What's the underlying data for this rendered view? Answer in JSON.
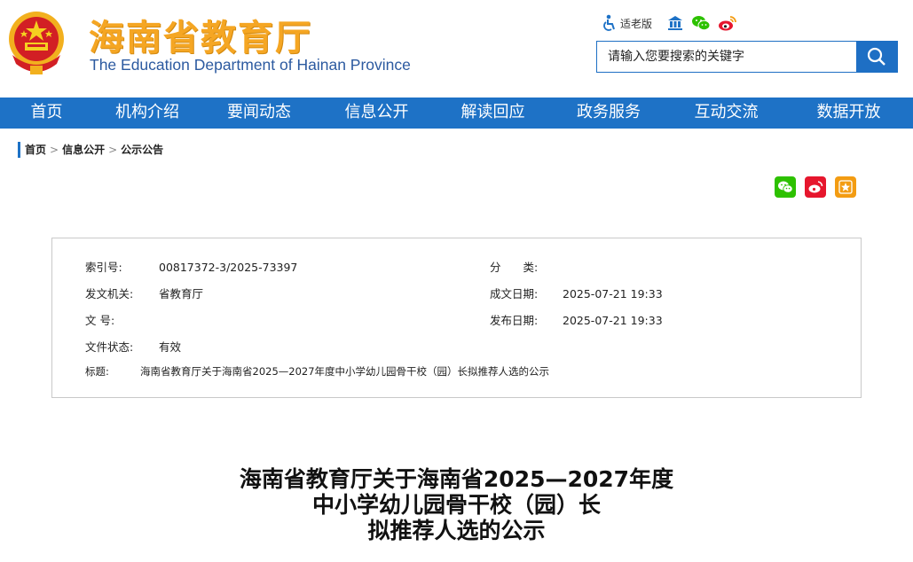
{
  "header": {
    "title_cn": "海南省教育厅",
    "title_en": "The Education Department of Hainan Province",
    "elder_mode_label": "适老版",
    "search_placeholder": "请输入您要搜索的关键字"
  },
  "nav": {
    "items": [
      "首页",
      "机构介绍",
      "要闻动态",
      "信息公开",
      "解读回应",
      "政务服务",
      "互动交流",
      "数据开放"
    ]
  },
  "breadcrumb": {
    "items": [
      "首页",
      "信息公开",
      "公示公告"
    ],
    "separator": ">"
  },
  "info": {
    "index_label": "索引号:",
    "index_value": "00817372-3/2025-73397",
    "category_label": "分　　类:",
    "category_value": "",
    "issuer_label": "发文机关:",
    "issuer_value": "省教育厅",
    "written_label": "成文日期:",
    "written_value": "2025-07-21 19:33",
    "docno_label": "文    号:",
    "docno_value": "",
    "published_label": "发布日期:",
    "published_value": "2025-07-21 19:33",
    "status_label": "文件状态:",
    "status_value": "有效",
    "title_label": "标题:",
    "title_value": "海南省教育厅关于海南省2025—2027年度中小学幼儿园骨干校（园）长拟推荐人选的公示"
  },
  "article": {
    "title_line1": "海南省教育厅关于海南省2025—2027年度",
    "title_line2": "中小学幼儿园骨干校（园）长",
    "title_line3": "拟推荐人选的公示"
  },
  "colors": {
    "brand_blue": "#1e72c6",
    "title_orange": "#f5a623",
    "wechat_green": "#2dc100",
    "weibo_red": "#e6162d",
    "fav_orange": "#f39c12"
  }
}
